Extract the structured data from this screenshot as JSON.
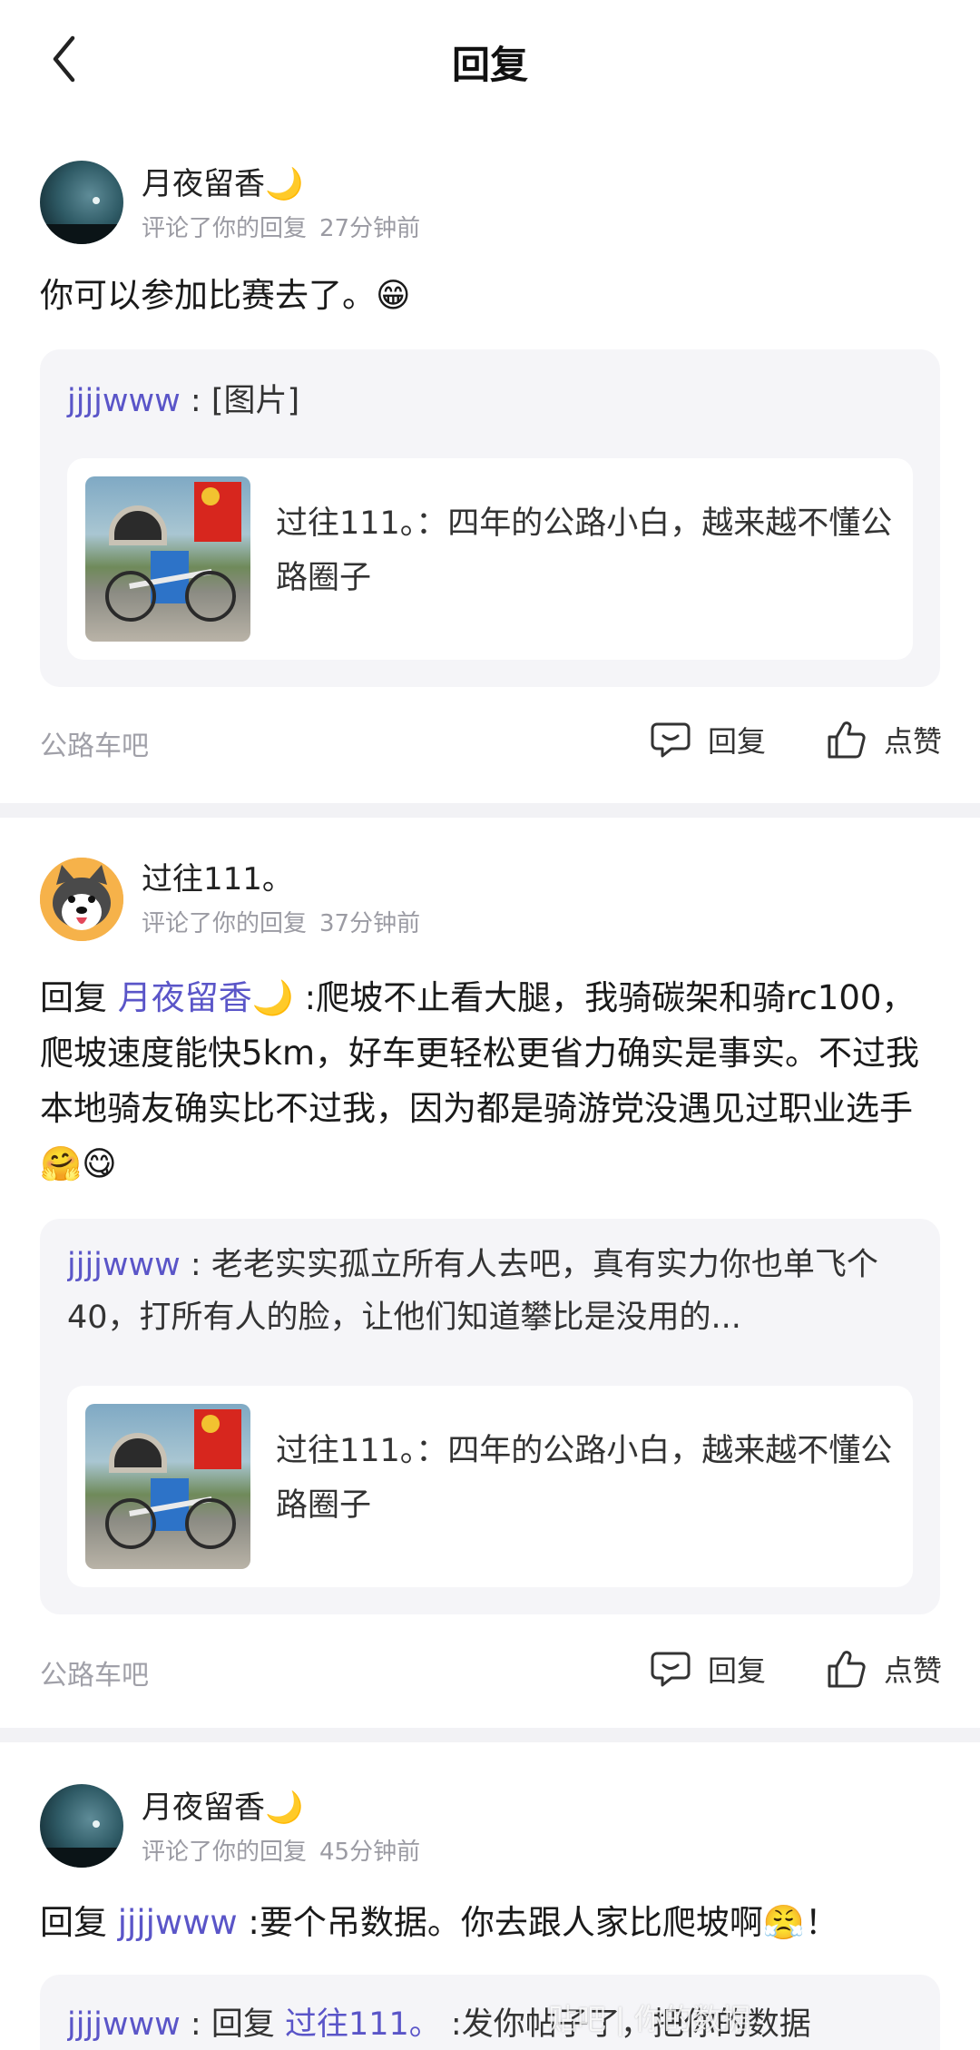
{
  "header": {
    "title": "回复"
  },
  "notifications": [
    {
      "user": "月夜留香🌙",
      "action": "评论了你的回复",
      "time": "27分钟前",
      "text": "你可以参加比赛去了。😁",
      "quote": {
        "user": "jjjjwww",
        "sep": " : ",
        "text": "[图片]"
      },
      "post": {
        "title": "过往111。：四年的公路小白，越来越不懂公路圈子"
      },
      "forum": "公路车吧",
      "reply_label": "回复",
      "like_label": "点赞"
    },
    {
      "user": "过往111。",
      "action": "评论了你的回复",
      "time": "37分钟前",
      "prefix": "回复",
      "mention": "月夜留香🌙",
      "text": " :爬坡不止看大腿，我骑碳架和骑rc100，爬坡速度能快5km，好车更轻松更省力确实是事实。不过我本地骑友确实比不过我，因为都是骑游党没遇见过职业选手🤗😋",
      "quote": {
        "user": "jjjjwww",
        "sep": " : ",
        "text": "老老实实孤立所有人去吧，真有实力你也单飞个40，打所有人的脸，让他们知道攀比是没用的..."
      },
      "post": {
        "title": "过往111。：四年的公路小白，越来越不懂公路圈子"
      },
      "forum": "公路车吧",
      "reply_label": "回复",
      "like_label": "点赞"
    },
    {
      "user": "月夜留香🌙",
      "action": "评论了你的回复",
      "time": "45分钟前",
      "prefix": "回复",
      "mention": "jjjjwww",
      "text": " :要个吊数据。你去跟人家比爬坡啊😤！",
      "quote": {
        "user": "jjjjwww",
        "sep": " : ",
        "prefix": "回复 ",
        "mention": "过往111。",
        "text": " :发你帖子了，把你的数据"
      }
    }
  ],
  "watermark": "贴吧 | 你的数据"
}
